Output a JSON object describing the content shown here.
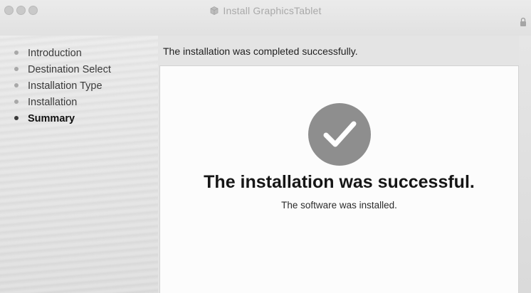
{
  "window": {
    "title": "Install GraphicsTablet"
  },
  "header": {
    "status_text": "The installation was completed successfully."
  },
  "sidebar": {
    "steps": [
      {
        "label": "Introduction",
        "current": false
      },
      {
        "label": "Destination Select",
        "current": false
      },
      {
        "label": "Installation Type",
        "current": false
      },
      {
        "label": "Installation",
        "current": false
      },
      {
        "label": "Summary",
        "current": true
      }
    ]
  },
  "main": {
    "title": "The installation was successful.",
    "subtitle": "The software was installed.",
    "success_icon": "checkmark-circle-icon"
  },
  "colors": {
    "success_icon_fill": "#8e8e8e",
    "panel_background": "#fcfcfc",
    "window_background": "#e4e4e4"
  }
}
